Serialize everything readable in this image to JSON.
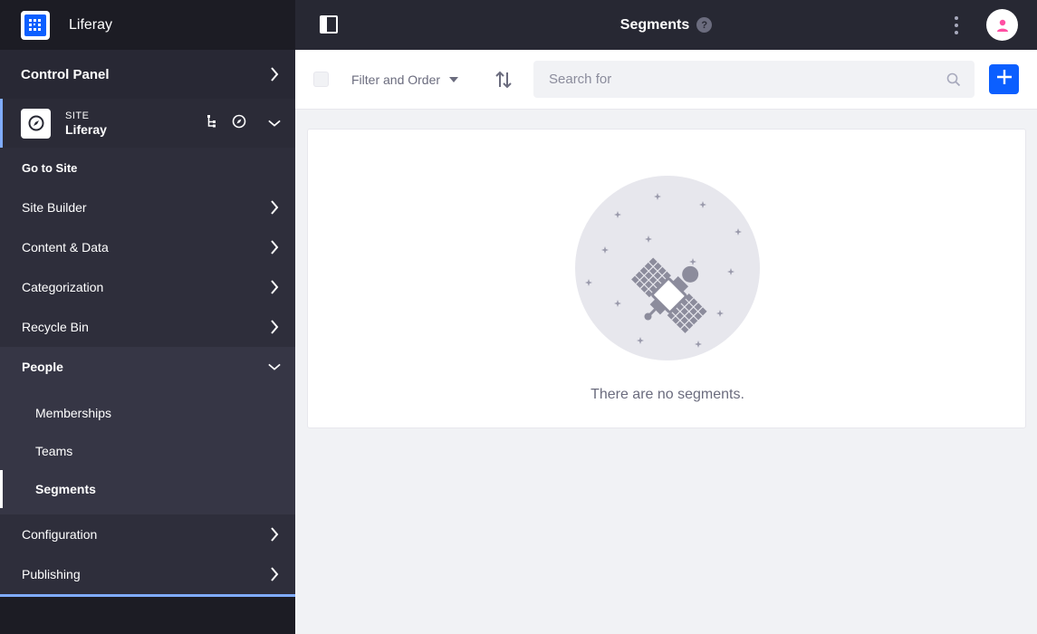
{
  "sidebar": {
    "brand": "Liferay",
    "control_panel": "Control Panel",
    "site": {
      "kind": "SITE",
      "name": "Liferay"
    },
    "go_to_site": "Go to Site",
    "menu": {
      "site_builder": "Site Builder",
      "content_data": "Content & Data",
      "categorization": "Categorization",
      "recycle_bin": "Recycle Bin",
      "people": "People",
      "configuration": "Configuration",
      "publishing": "Publishing"
    },
    "people_items": [
      "Memberships",
      "Teams",
      "Segments"
    ]
  },
  "topbar": {
    "title": "Segments",
    "help_glyph": "?"
  },
  "toolbar": {
    "filter_label": "Filter and Order",
    "search_placeholder": "Search for"
  },
  "main": {
    "empty_message": "There are no segments."
  },
  "colors": {
    "accent": "#0b5fff",
    "sidebar_bg": "#1c1c24",
    "topbar_bg": "#272833",
    "active_border": "#80acff"
  },
  "icons": [
    "liferay-logo-icon",
    "chevron-right-icon",
    "chevron-down-icon",
    "compass-icon",
    "site-tree-icon",
    "sidebar-toggle-icon",
    "help-icon",
    "kebab-menu-icon",
    "user-icon",
    "caret-down-icon",
    "sort-icon",
    "search-icon",
    "plus-icon",
    "satellite-illustration"
  ]
}
